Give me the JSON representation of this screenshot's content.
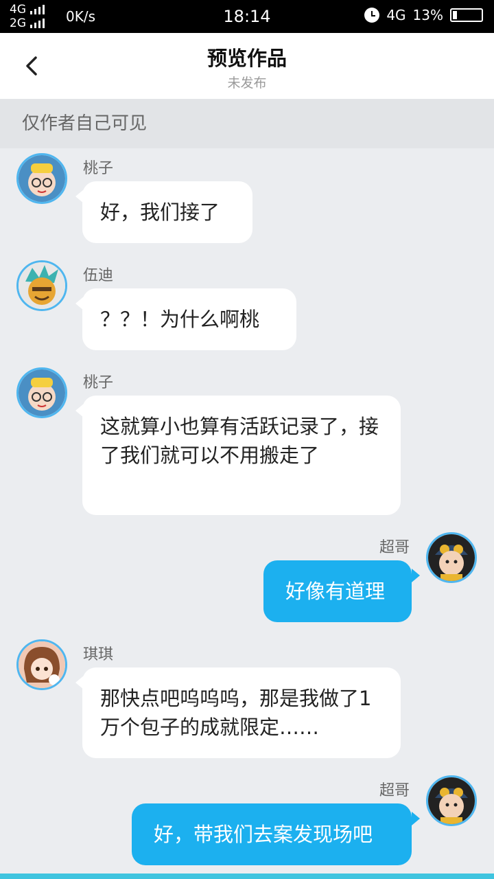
{
  "status_bar": {
    "net1": "4G",
    "net2": "2G",
    "speed": "0K/s",
    "time": "18:14",
    "net_type": "4G",
    "battery": "13%"
  },
  "nav": {
    "title": "预览作品",
    "subtitle": "未发布"
  },
  "notice": "仅作者自己可见",
  "messages": [
    {
      "name": "桃子",
      "text": "好，我们接了"
    },
    {
      "name": "伍迪",
      "text": "？？！为什么啊桃"
    },
    {
      "name": "桃子",
      "text": "这就算小也算有活跃记录了，接了我们就可以不用搬走了"
    },
    {
      "name": "超哥",
      "text": "好像有道理"
    },
    {
      "name": "琪琪",
      "text": "那快点吧呜呜呜，那是我做了1万个包子的成就限定……"
    },
    {
      "name": "超哥",
      "text": "好，带我们去案发现场吧"
    }
  ],
  "colors": {
    "accent": "#1cb0ef",
    "avatar_ring": "#4fb6ef",
    "background": "#ebedf0"
  }
}
